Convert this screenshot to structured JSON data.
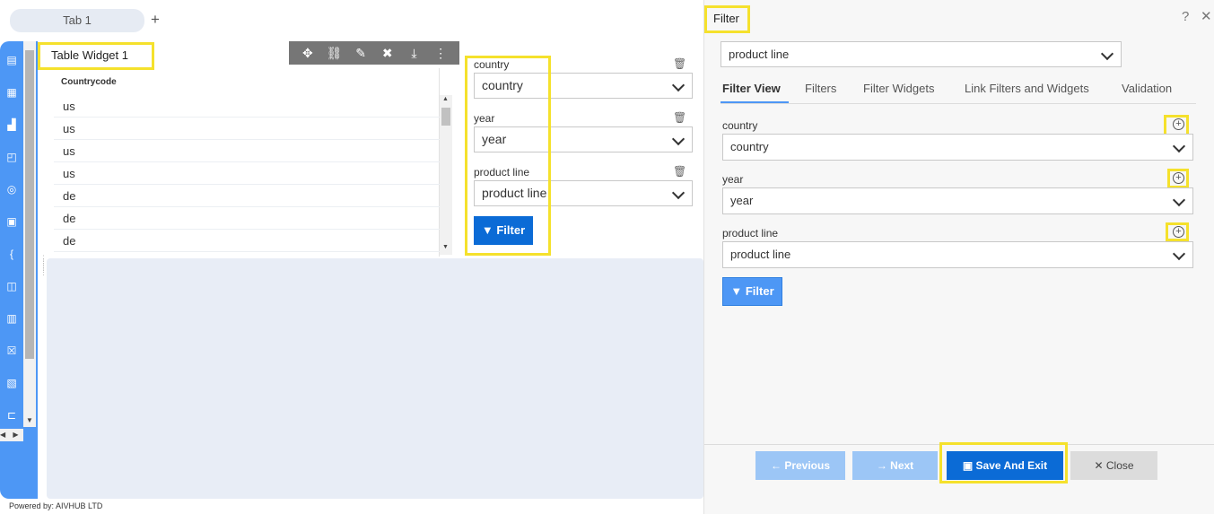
{
  "tabs": {
    "items": [
      {
        "label": "Tab 1"
      }
    ],
    "add_label": "+"
  },
  "table_widget": {
    "title": "Table Widget 1",
    "column_header": "Countrycode",
    "rows": [
      "us",
      "us",
      "us",
      "us",
      "de",
      "de",
      "de"
    ]
  },
  "canvas_filter": {
    "fields": [
      {
        "label": "country",
        "value": "country"
      },
      {
        "label": "year",
        "value": "year"
      },
      {
        "label": "product line",
        "value": "product line"
      }
    ],
    "button_label": "Filter"
  },
  "footer": {
    "text": "Powered by: AIVHUB LTD"
  },
  "panel": {
    "title": "Filter",
    "selected_widget": "product line",
    "tabs": [
      "Filter View",
      "Filters",
      "Filter Widgets",
      "Link Filters and Widgets",
      "Validation"
    ],
    "fields": [
      {
        "label": "country",
        "value": "country"
      },
      {
        "label": "year",
        "value": "year"
      },
      {
        "label": "product line",
        "value": "product line"
      }
    ],
    "filter_button": "Filter",
    "buttons": {
      "previous": "Previous",
      "next": "Next",
      "save": "Save And Exit",
      "close": "Close"
    }
  },
  "colors": {
    "accent": "#0b6bd6",
    "rail": "#4d97f5",
    "highlight": "#f5e12c"
  }
}
